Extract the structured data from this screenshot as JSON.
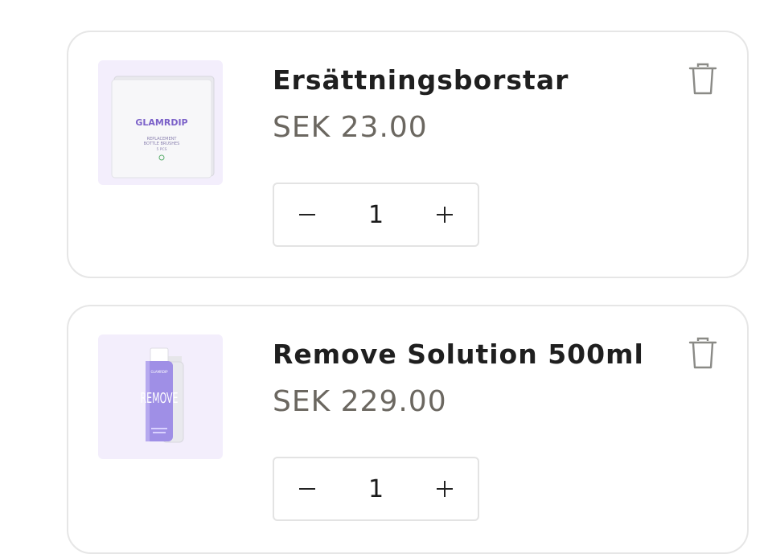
{
  "cart": {
    "items": [
      {
        "title": "Ersättningsborstar",
        "price": "SEK 23.00",
        "quantity": "1",
        "image": {
          "brand": "GLAMRDIP",
          "line1": "REPLACEMENT",
          "line2": "BOTTLE BRUSHES",
          "line3": "5 PCS"
        }
      },
      {
        "title": "Remove Solution 500ml",
        "price": "SEK 229.00",
        "quantity": "1",
        "image": {
          "brand": "GLAMRDIP",
          "label": "REMOVE"
        }
      }
    ]
  },
  "icons": {
    "delete": "trash-icon",
    "decrease": "minus-icon",
    "increase": "plus-icon"
  },
  "colors": {
    "card_border": "#e6e6e6",
    "thumb_bg": "#f3eefc",
    "price_text": "#6b6760",
    "bottle_purple": "#9f8fe6",
    "brand_purple": "#7c62c9"
  }
}
